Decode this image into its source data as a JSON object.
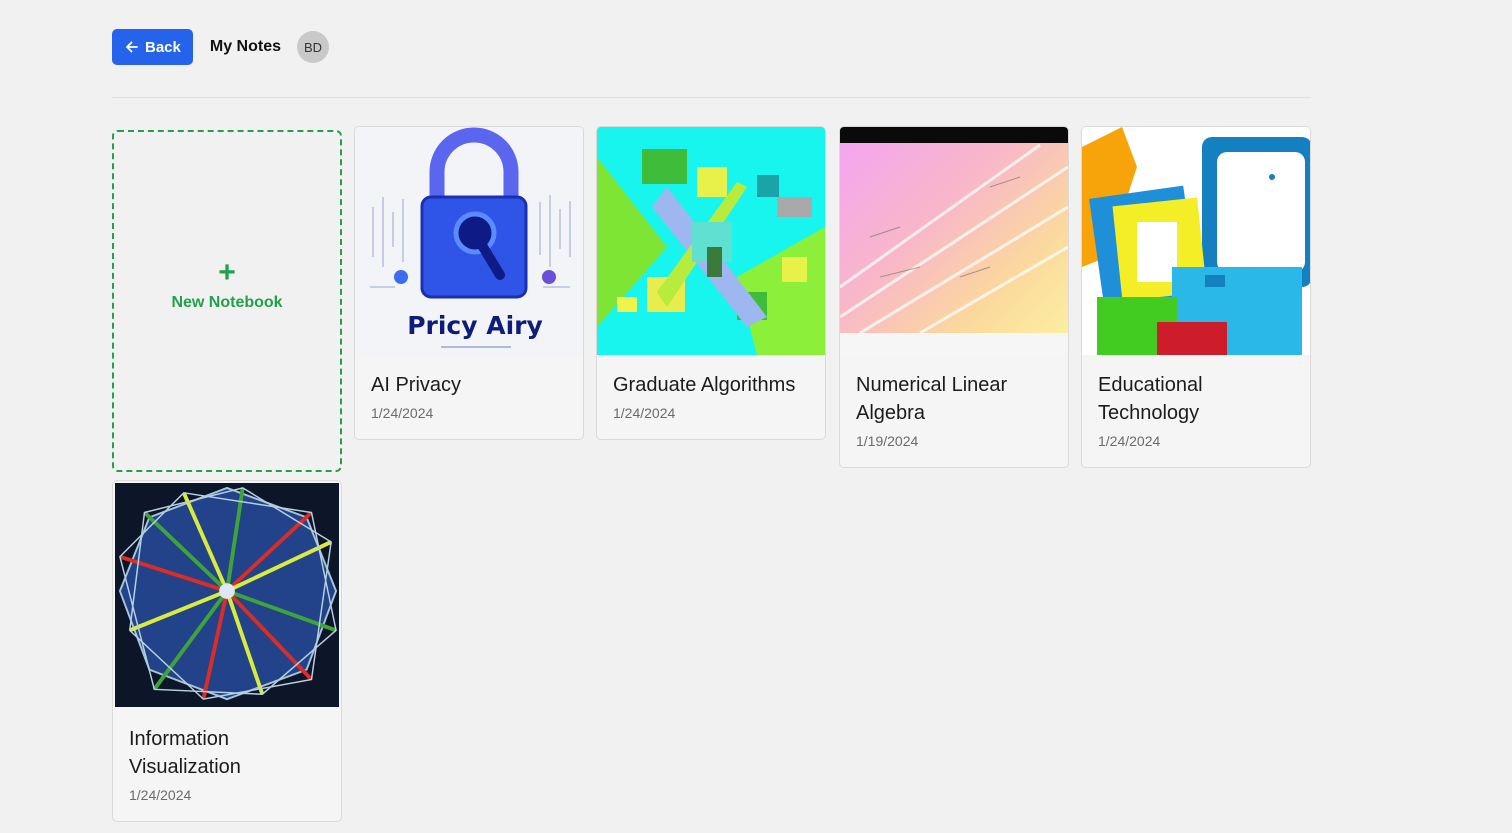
{
  "header": {
    "back_label": "Back",
    "title": "My Notes",
    "avatar_initials": "BD"
  },
  "new_notebook": {
    "icon": "plus-icon",
    "label": "New Notebook"
  },
  "notebooks": [
    {
      "title": "AI Privacy",
      "date": "1/24/2024",
      "image": "padlock-illustration",
      "image_text": "Pricy Airy"
    },
    {
      "title": "Graduate Algorithms",
      "date": "1/24/2024",
      "image": "abstract-geometric-shapes"
    },
    {
      "title": "Numerical Linear Algebra",
      "date": "1/19/2024",
      "image": "rainbow-math-formulas"
    },
    {
      "title": "Educational Technology",
      "date": "1/24/2024",
      "image": "colorful-tablet-devices"
    },
    {
      "title": "Information Visualization",
      "date": "1/24/2024",
      "image": "star-polygon-network"
    }
  ],
  "colors": {
    "accent": "#2563eb",
    "new_notebook": "#22a04b",
    "background": "#f1f1f1"
  }
}
